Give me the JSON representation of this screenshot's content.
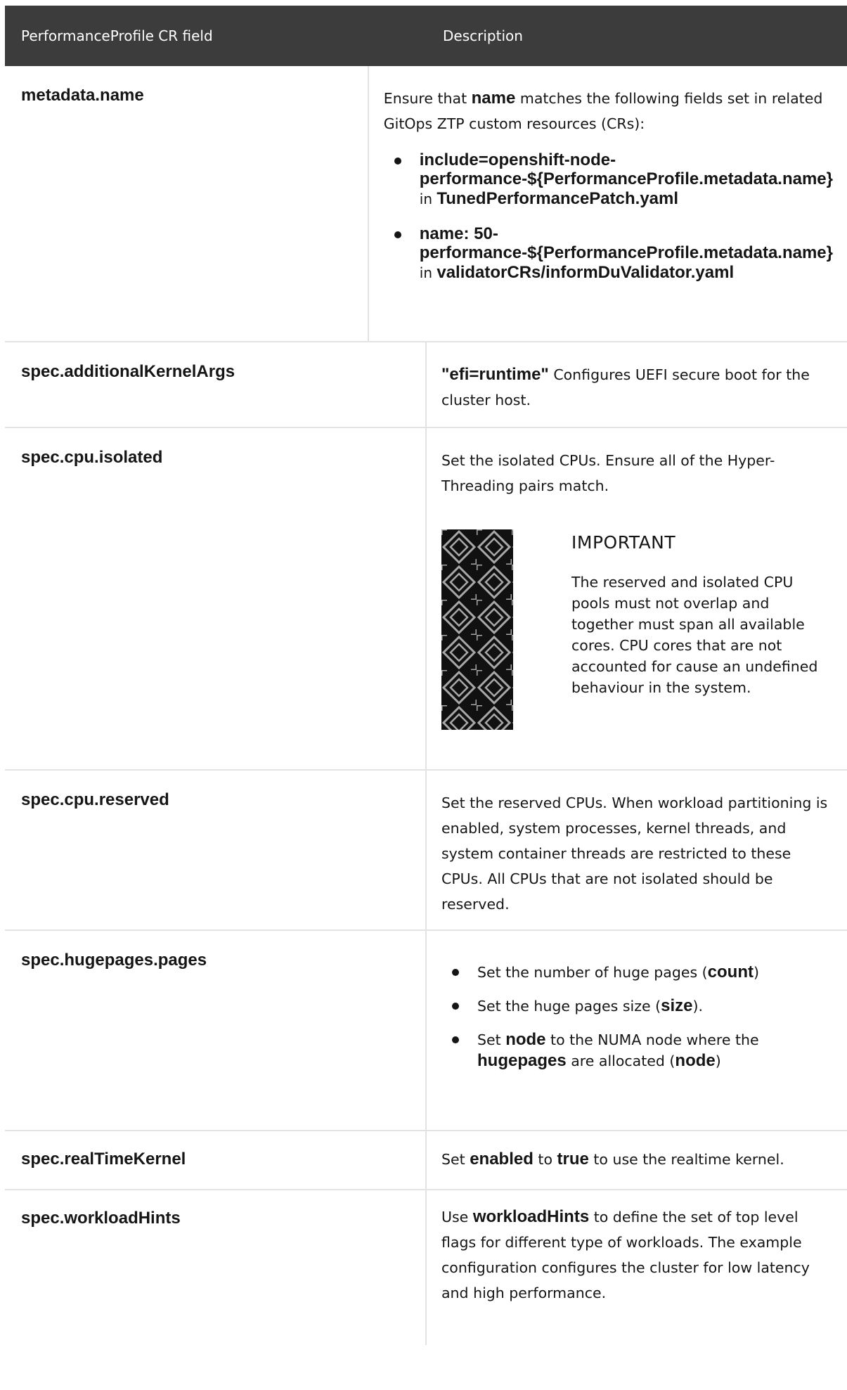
{
  "table": {
    "header": {
      "col1": "PerformanceProfile CR field",
      "col2": "Description"
    },
    "rows": {
      "metadata_name": {
        "field": "metadata.name",
        "desc": {
          "pre": "Ensure that ",
          "b": "name",
          "post": " matches the following fields set in related GitOps ZTP custom resources (CRs):"
        },
        "bullets": [
          {
            "b1": "include=openshift-node-performance-${PerformanceProfile.metadata.name}",
            "mid": " in ",
            "b2": "TunedPerformancePatch.yaml"
          },
          {
            "b1": "name: 50-performance-${PerformanceProfile.metadata.name}",
            "mid": " in ",
            "b2": "validatorCRs/informDuValidator.yaml"
          }
        ]
      },
      "additional_kernel_args": {
        "field": "spec.additionalKernelArgs",
        "b": "\"efi=runtime\"",
        "post": " Configures UEFI secure boot for the cluster host."
      },
      "cpu_isolated": {
        "field": "spec.cpu.isolated",
        "desc": "Set the isolated CPUs. Ensure all of the Hyper-Threading pairs match.",
        "admonition": {
          "title": "IMPORTANT",
          "text": "The reserved and isolated CPU pools must not overlap and together must span all available cores. CPU cores that are not accounted for cause an undefined behaviour in the system."
        }
      },
      "cpu_reserved": {
        "field": "spec.cpu.reserved",
        "desc": "Set the reserved CPUs. When workload partitioning is enabled, system processes, kernel threads, and system container threads are restricted to these CPUs. All CPUs that are not isolated should be reserved."
      },
      "hugepages": {
        "field": "spec.hugepages.pages",
        "b1": {
          "pre": "Set the number of huge pages (",
          "b": "count",
          "post": ")"
        },
        "b2": {
          "pre": "Set the huge pages size (",
          "b": "size",
          "post": ")."
        },
        "b3": {
          "pre": "Set ",
          "b": "node",
          "mid": " to the NUMA node where the ",
          "b2": "hugepages",
          "mid2": " are allocated (",
          "b3": "node",
          "post": ")"
        }
      },
      "realtime": {
        "field": "spec.realTimeKernel",
        "pre": "Set ",
        "b": "enabled",
        "mid": " to ",
        "b2": "true",
        "post": " to use the realtime kernel."
      },
      "workload_hints": {
        "field": "spec.workloadHints",
        "pre": "Use ",
        "b": "workloadHints",
        "post": " to define the set of top level flags for different type of workloads. The example configuration configures the cluster for low latency and high performance."
      }
    }
  },
  "icons": {
    "admonition": "important-pattern-icon"
  },
  "colors": {
    "header_bg": "#3c3c3c",
    "border": "#e3e3e3",
    "text": "#151515"
  }
}
